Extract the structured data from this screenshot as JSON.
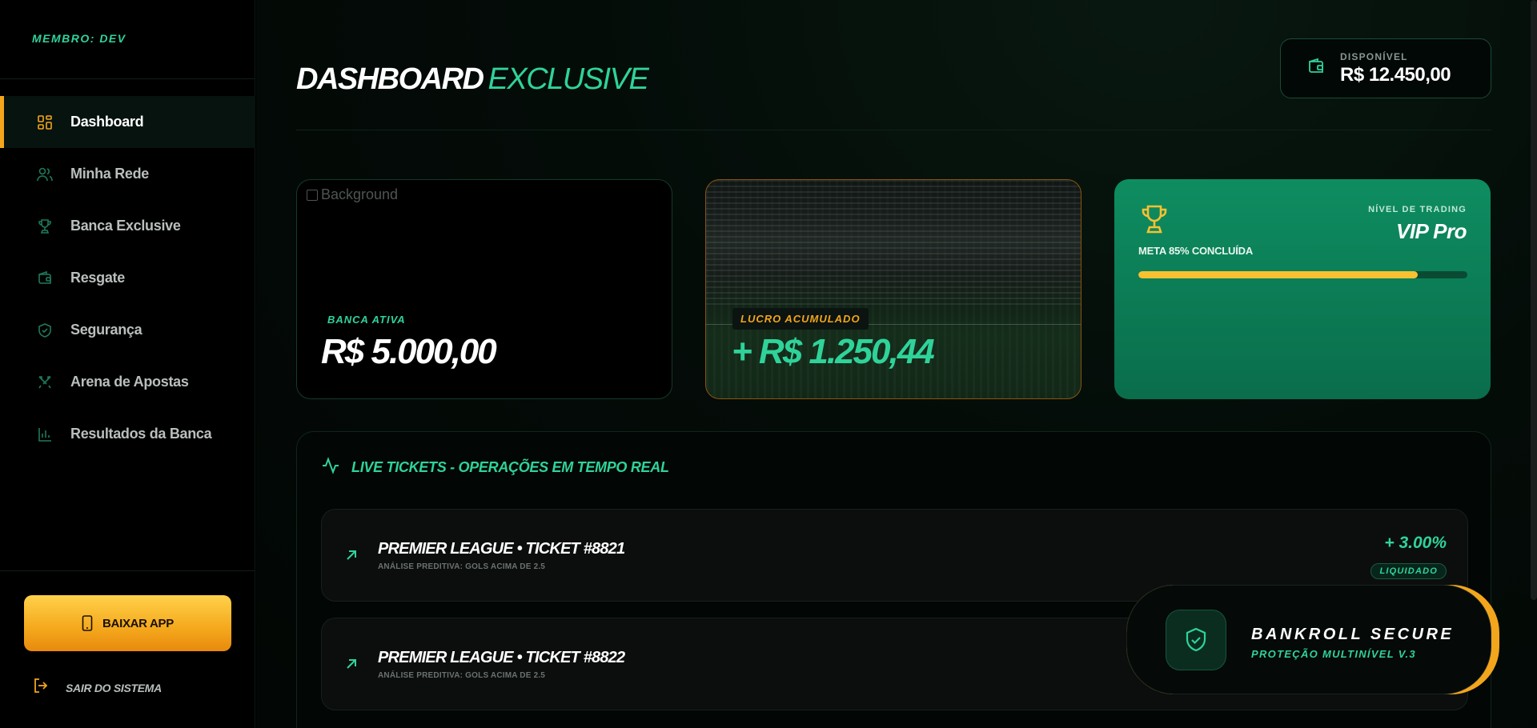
{
  "sidebar": {
    "member": "MEMBRO: DEV",
    "nav": [
      {
        "label": "Dashboard",
        "icon": "grid-icon",
        "active": true
      },
      {
        "label": "Minha Rede",
        "icon": "users-icon"
      },
      {
        "label": "Banca Exclusive",
        "icon": "trophy-icon"
      },
      {
        "label": "Resgate",
        "icon": "wallet-icon"
      },
      {
        "label": "Segurança",
        "icon": "shield-icon"
      },
      {
        "label": "Arena de Apostas",
        "icon": "swords-icon"
      },
      {
        "label": "Resultados da Banca",
        "icon": "bar-chart-icon"
      }
    ],
    "download_label": "BAIXAR APP",
    "logout_label": "SAIR DO SISTEMA"
  },
  "header": {
    "title_main": "DASHBOARD",
    "title_accent": "EXCLUSIVE",
    "balance_caption": "DISPONÍVEL",
    "balance_value": "R$ 12.450,00"
  },
  "cards": {
    "banca": {
      "image_alt": "Background",
      "badge": "BANCA ATIVA",
      "amount": "R$ 5.000,00"
    },
    "lucro": {
      "badge": "LUCRO ACUMULADO",
      "amount": "+ R$ 1.250,44"
    },
    "level": {
      "caption": "NÍVEL DE TRADING",
      "value": "VIP Pro",
      "meta": "META 85% CONCLUÍDA",
      "progress": 0.85
    }
  },
  "live": {
    "title": "LIVE TICKETS - OPERAÇÕES EM TEMPO REAL",
    "tickets": [
      {
        "name": "PREMIER LEAGUE • TICKET #8821",
        "sub": "ANÁLISE PREDITIVA: GOLS ACIMA DE 2.5",
        "pct": "+ 3.00%",
        "status": "LIQUIDADO"
      },
      {
        "name": "PREMIER LEAGUE • TICKET #8822",
        "sub": "ANÁLISE PREDITIVA: GOLS ACIMA DE 2.5"
      }
    ]
  },
  "secure": {
    "title": "BANKROLL SECURE",
    "subtitle": "PROTEÇÃO MULTINÍVEL V.3"
  },
  "colors": {
    "accent_green": "#2fd39a",
    "accent_orange": "#f3a51c",
    "level_card": "#0e8d61"
  }
}
